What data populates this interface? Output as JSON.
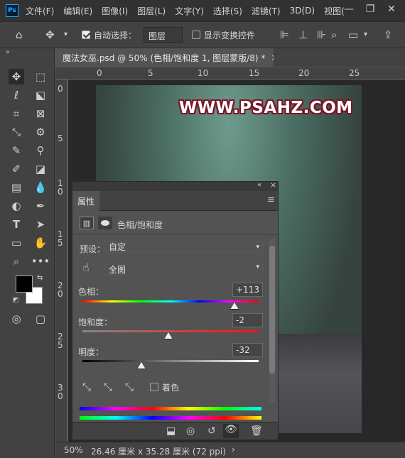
{
  "app": {
    "logo": "Ps"
  },
  "menu": [
    "文件(F)",
    "编辑(E)",
    "图像(I)",
    "图层(L)",
    "文字(Y)",
    "选择(S)",
    "滤镜(T)",
    "3D(D)",
    "视图("
  ],
  "window_controls": {
    "minimize": "—",
    "restore": "❐",
    "close": "✕"
  },
  "options": {
    "auto_select_label": "自动选择：",
    "auto_select_checked": true,
    "target_value": "图层",
    "show_transform_label": "显示变换控件",
    "show_transform_checked": false
  },
  "panels_collapse": "«",
  "document_tab": {
    "title": "魔法女巫.psd @ 50% (色相/饱和度 1, 图层蒙版/8) *",
    "close": "×"
  },
  "ruler": {
    "h": [
      "0",
      "5",
      "10",
      "15",
      "20",
      "25"
    ],
    "v": [
      [
        "0"
      ],
      [
        "5"
      ],
      [
        "1",
        "0"
      ],
      [
        "1",
        "5"
      ],
      [
        "2",
        "0"
      ],
      [
        "2",
        "5"
      ],
      [
        "3",
        "0"
      ]
    ]
  },
  "canvas": {
    "watermark": "WWW.PSAHZ.COM"
  },
  "status": {
    "zoom": "50%",
    "doc_size": "26.46 厘米 x 35.28 厘米 (72 ppi)",
    "arrow": "›"
  },
  "properties": {
    "tab_label": "属性",
    "collapse": "«",
    "close": "×",
    "menu": "≡",
    "adjustment_title": "色相/饱和度",
    "preset_label": "预设：",
    "preset_value": "自定",
    "range_value": "全图",
    "hue": {
      "label": "色相：",
      "value": "+113"
    },
    "saturation": {
      "label": "饱和度：",
      "value": "-2"
    },
    "lightness": {
      "label": "明度：",
      "value": "-32"
    },
    "colorize_label": "着色",
    "colorize_checked": false
  },
  "colors": {
    "menubar_bg": "#323232",
    "panel_bg": "#535353",
    "toolbar_bg": "#424242",
    "canvas_bg": "#282828",
    "watermark_stroke": "#7a1828",
    "accent": "#31a8ff"
  }
}
